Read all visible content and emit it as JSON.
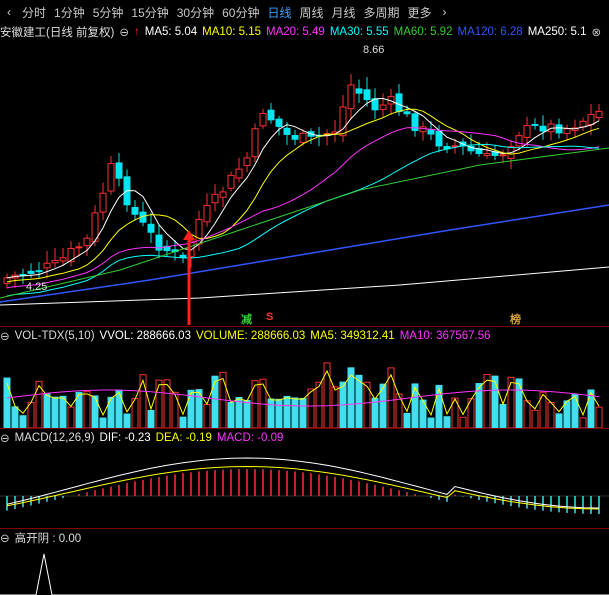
{
  "toolbar": {
    "prev_icon": "chevron-left-icon",
    "tabs": [
      "分时",
      "1分钟",
      "5分钟",
      "15分钟",
      "30分钟",
      "60分钟",
      "日线",
      "周线",
      "月线",
      "多周期",
      "更多"
    ],
    "active_tab": "日线",
    "more_icon": "chevron-right-icon"
  },
  "main_header": {
    "title": "安徽建工(日线 前复权)",
    "ma5": "MA5: 5.04",
    "ma10": "MA10: 5.15",
    "ma20": "MA20: 5.49",
    "ma30": "MA30: 5.55",
    "ma60": "MA60: 5.92",
    "ma120": "MA120: 6.28",
    "ma250": "MA250: 5.1",
    "colors": {
      "ma5": "#ffffff",
      "ma10": "#ffff00",
      "ma20": "#ff33ff",
      "ma30": "#00ffff",
      "ma60": "#33cc33",
      "ma120": "#3355ff",
      "ma250": "#ffffff"
    }
  },
  "price_labels": {
    "high": "8.66",
    "low": "4.25"
  },
  "signals": {
    "jian": "减",
    "s": "S",
    "bang": "榜"
  },
  "volume_header": {
    "title": "VOL-TDX(5,10)",
    "vvol": "VVOL: 288666.03",
    "volume": "VOLUME: 288666.03",
    "ma5": "MA5: 349312.41",
    "ma10": "MA10: 367567.56"
  },
  "macd_header": {
    "title": "MACD(12,26,9)",
    "dif": "DIF: -0.23",
    "dea": "DEA: -0.19",
    "macd": "MACD: -0.09"
  },
  "gkyin_header": {
    "title": "高开阴 : 0.00"
  }
}
